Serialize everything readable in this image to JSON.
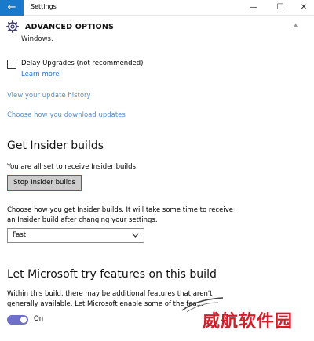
{
  "window": {
    "title": "Settings",
    "back_glyph": "←",
    "minimize_glyph": "—",
    "maximize_glyph": "☐",
    "close_glyph": "✕"
  },
  "header": {
    "icon": "gear-icon",
    "title": "ADVANCED OPTIONS"
  },
  "clipped_text": "Windows.",
  "delay_upgrades": {
    "label": "Delay Upgrades (not recommended)",
    "checked": false,
    "learn_more": "Learn more"
  },
  "links": {
    "update_history": "View your update history",
    "download_updates": "Choose how you download updates"
  },
  "insider": {
    "title": "Get Insider builds",
    "status": "You are all set to receive Insider builds.",
    "stop_button": "Stop Insider builds",
    "choose_text": "Choose how you get Insider builds. It will take some time to receive an Insider build after changing your settings.",
    "ring_selected": "Fast"
  },
  "try_features": {
    "title": "Let Microsoft try features on this build",
    "description": "Within this build, there may be additional features that aren't generally available. Let Microsoft enable some of the fea...",
    "toggle_on": true,
    "toggle_label": "On"
  },
  "watermark": "威航软件园",
  "colors": {
    "accent": "#1979ca",
    "link": "#5b8fc9",
    "toggle": "#6e6fc8",
    "focus_border": "#c9342f",
    "watermark": "#d01f2a"
  }
}
